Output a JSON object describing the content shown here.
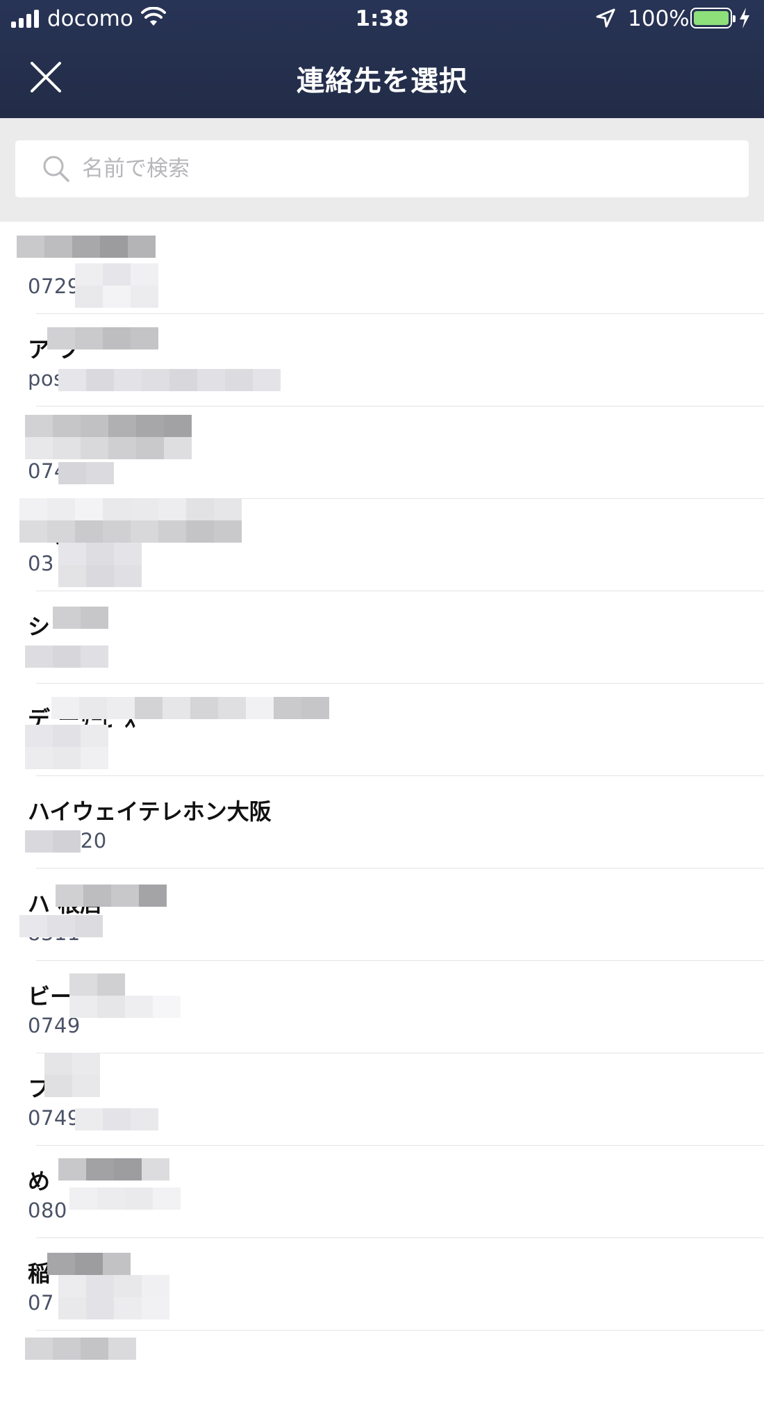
{
  "status_bar": {
    "carrier": "docomo",
    "time": "1:38",
    "battery": "100%"
  },
  "header": {
    "title": "連絡先を選択"
  },
  "search": {
    "placeholder": "名前で検索"
  },
  "colors": {
    "header_bg": "#27324f",
    "search_bg": "#ebebec",
    "battery_green": "#8ee07a"
  },
  "contacts": [
    {
      "name": "",
      "sub": "0729"
    },
    {
      "name": "ア          ブ",
      "sub": "pos                        ameblo.jp"
    },
    {
      "name": "",
      "sub": "074       250"
    },
    {
      "name": "                     ー事務所",
      "sub": "03"
    },
    {
      "name": "シ",
      "sub": "          951"
    },
    {
      "name": "デ                           ーｻｰﾋﾞｽ",
      "sub": "        7377"
    },
    {
      "name": "ハイウェイテレホン大阪",
      "sub": "       761620"
    },
    {
      "name": "ハ          根店",
      "sub": "       8311"
    },
    {
      "name": "ビー",
      "sub": "0749"
    },
    {
      "name": "フ",
      "sub": "0749"
    },
    {
      "name": "め",
      "sub": "080"
    },
    {
      "name": "稲",
      "sub": "07"
    },
    {
      "name": "",
      "sub": ""
    }
  ]
}
